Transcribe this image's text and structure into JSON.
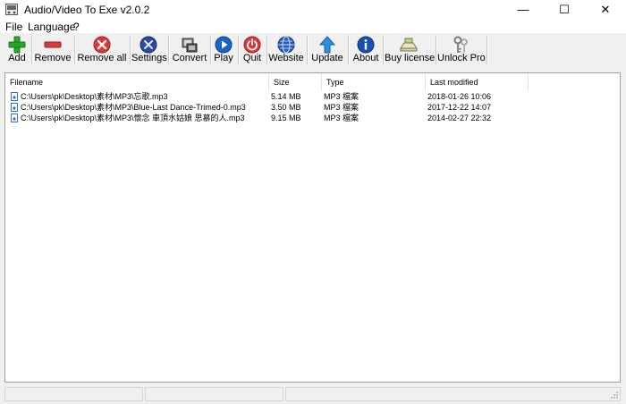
{
  "window": {
    "title": "Audio/Video To Exe v2.0.2",
    "min_glyph": "—",
    "max_glyph": "☐",
    "close_glyph": "✕"
  },
  "menu": [
    {
      "label": "File"
    },
    {
      "label": "Language"
    },
    {
      "label": "?"
    }
  ],
  "toolbar": {
    "buttons": [
      {
        "id": "add",
        "label": "Add",
        "icon": "plus-icon"
      },
      {
        "id": "remove",
        "label": "Remove",
        "icon": "minus-icon"
      },
      {
        "id": "remove-all",
        "label": "Remove all",
        "icon": "x-circle-icon"
      },
      {
        "id": "settings",
        "label": "Settings",
        "icon": "tools-icon"
      },
      {
        "id": "convert",
        "label": "Convert",
        "icon": "film-convert-icon"
      },
      {
        "id": "play",
        "label": "Play",
        "icon": "play-icon"
      },
      {
        "id": "quit",
        "label": "Quit",
        "icon": "power-icon"
      },
      {
        "id": "website",
        "label": "Website",
        "icon": "globe-icon"
      },
      {
        "id": "update",
        "label": "Update",
        "icon": "up-arrow-icon"
      },
      {
        "id": "about",
        "label": "About",
        "icon": "info-icon"
      },
      {
        "id": "buy-license",
        "label": "Buy license",
        "icon": "cart-icon"
      },
      {
        "id": "unlock-pro",
        "label": "Unlock Pro",
        "icon": "key-icon"
      }
    ]
  },
  "list": {
    "columns": {
      "filename": "Filename",
      "size": "Size",
      "type": "Type",
      "modified": "Last modified"
    },
    "rows": [
      {
        "filename": "C:\\Users\\pk\\Desktop\\素材\\MP3\\忘歌.mp3",
        "size": "5.14 MB",
        "type": "MP3 檔案",
        "modified": "2018-01-26 10:06"
      },
      {
        "filename": "C:\\Users\\pk\\Desktop\\素材\\MP3\\Blue-Last Dance-Trimed-0.mp3",
        "size": "3.50 MB",
        "type": "MP3 檔案",
        "modified": "2017-12-22 14:07"
      },
      {
        "filename": "C:\\Users\\pk\\Desktop\\素材\\MP3\\懷念  車頂水姑娘  思慕的人.mp3",
        "size": "9.15 MB",
        "type": "MP3 檔案",
        "modified": "2014-02-27 22:32"
      }
    ]
  },
  "colors": {
    "green": "#2aa52a",
    "red": "#d83a3a",
    "blue": "#1a63c9",
    "navy": "#2b4aa0"
  }
}
